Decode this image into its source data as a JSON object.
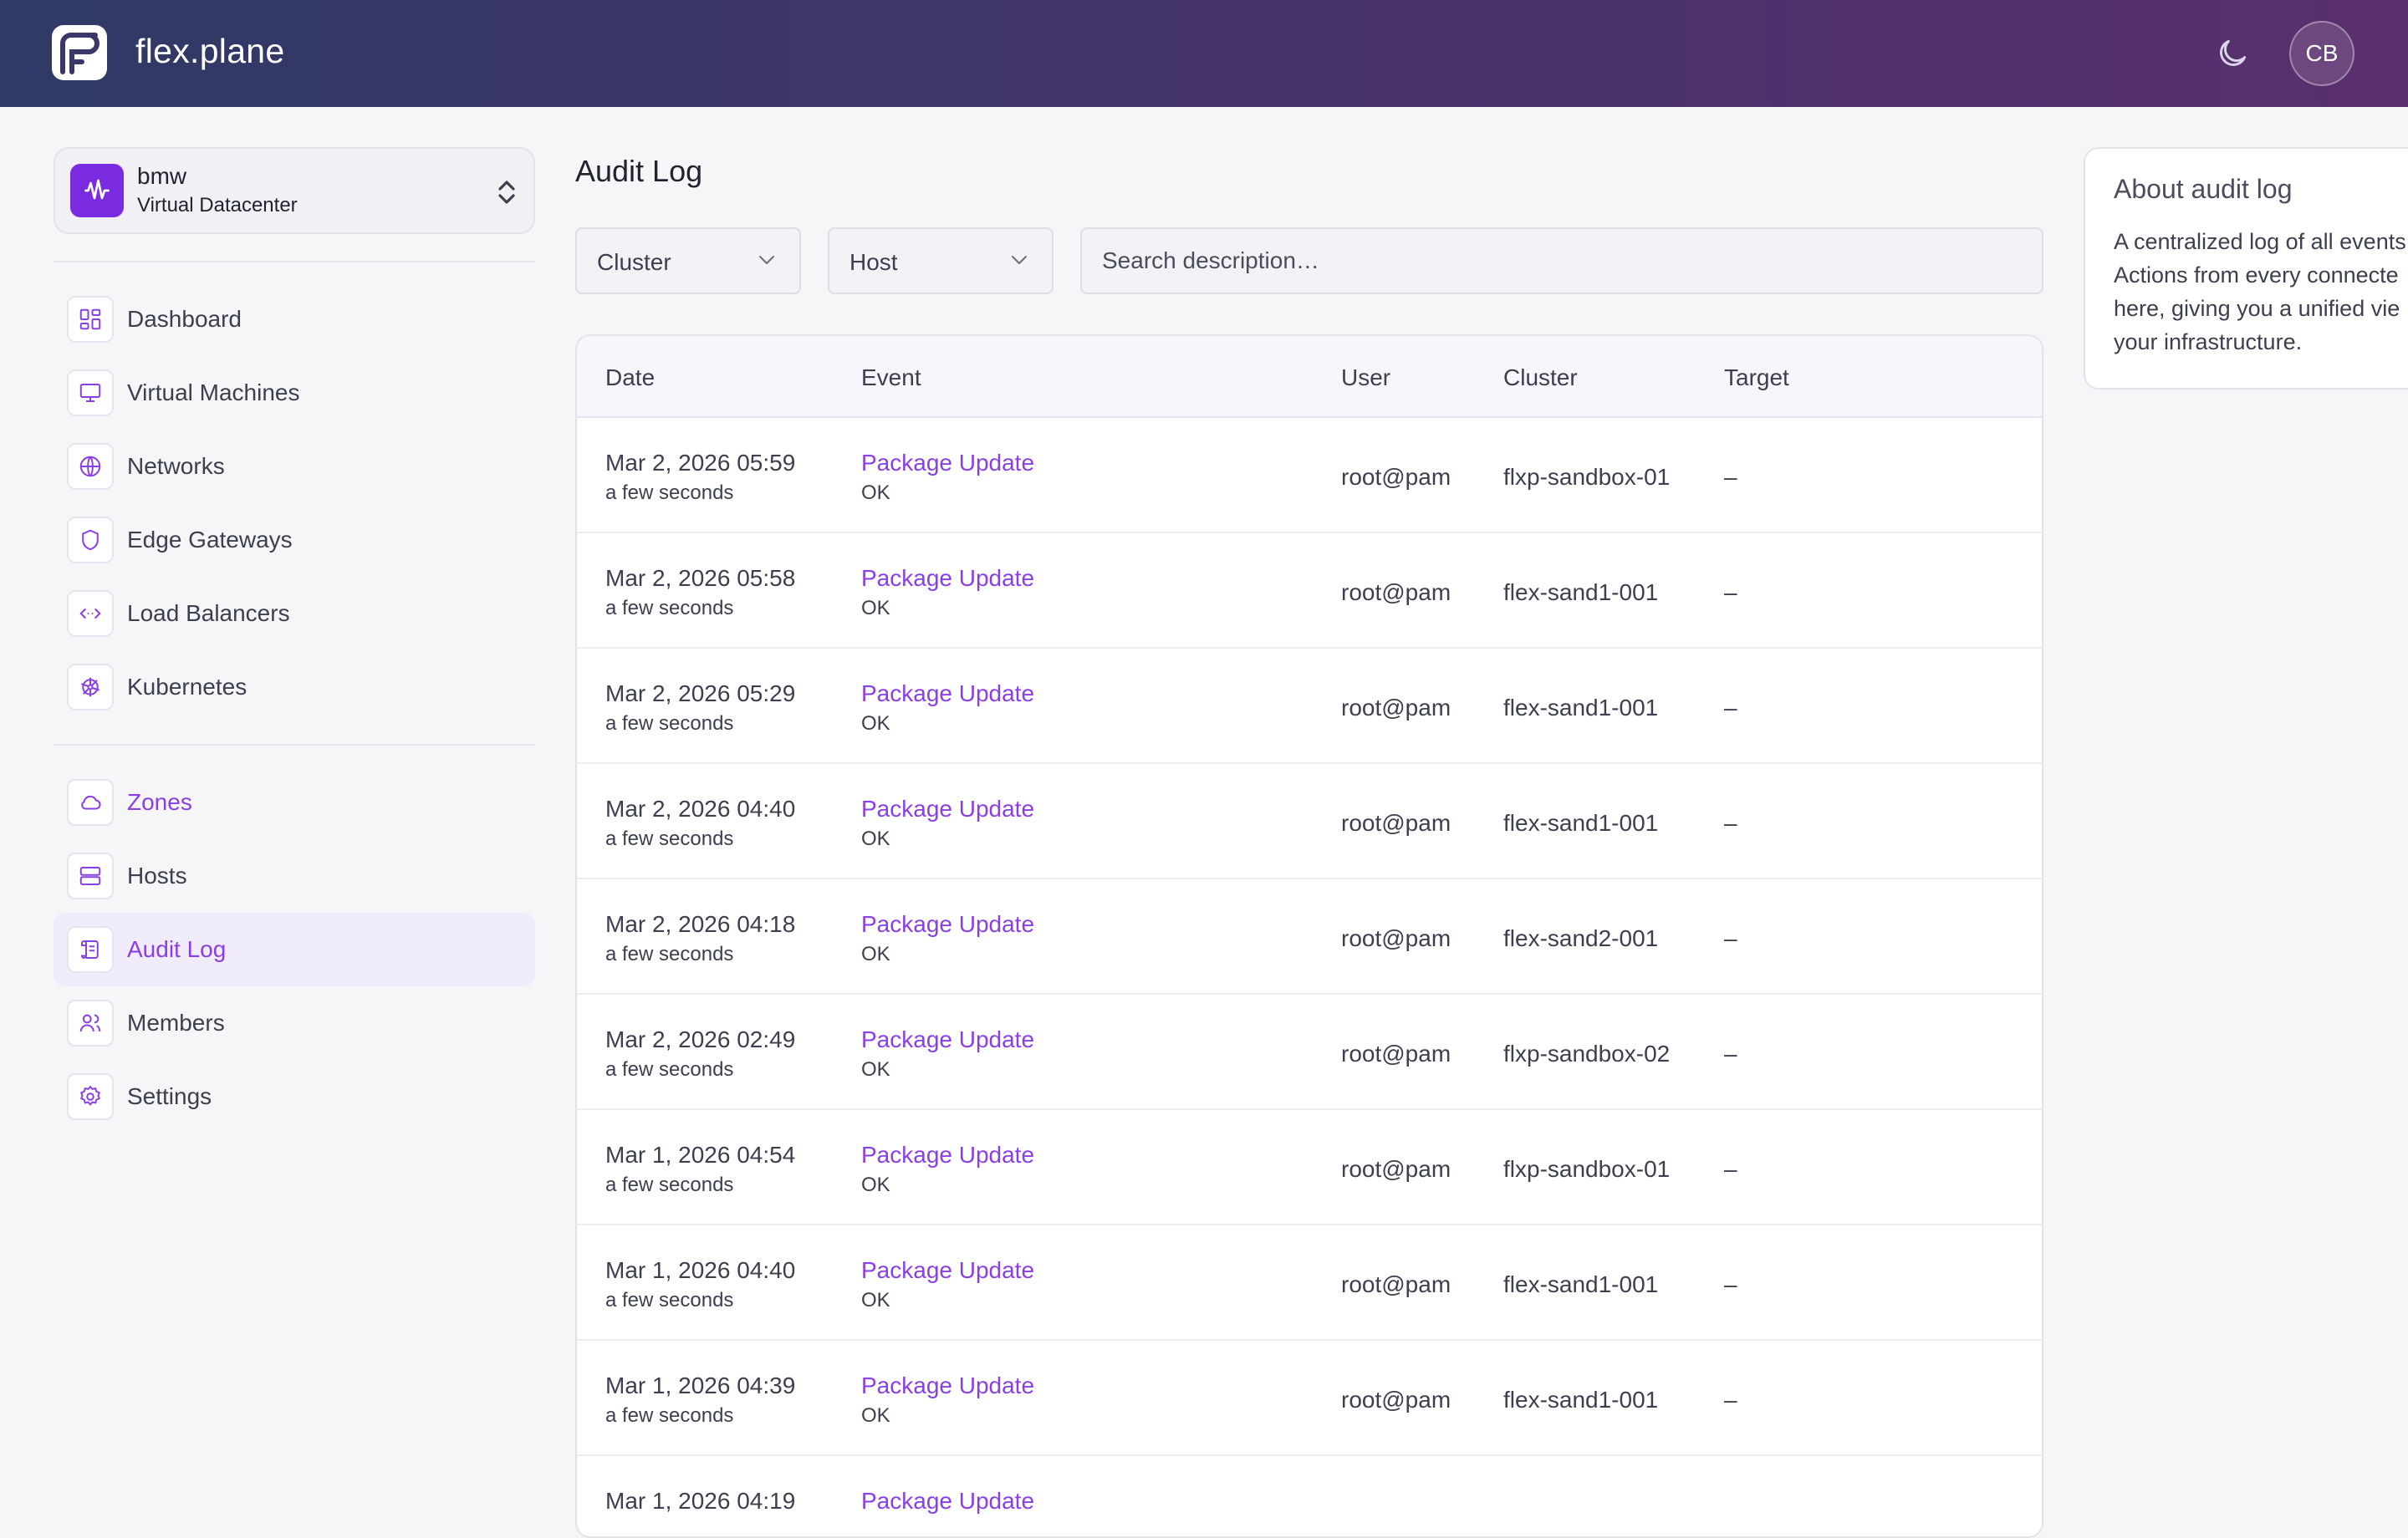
{
  "header": {
    "brand": "flex.plane",
    "avatar_initials": "CB",
    "theme_icon": "moon-icon",
    "colors": {
      "gradient_start": "#2f3a66",
      "gradient_end": "#5a2f6e"
    }
  },
  "sidebar": {
    "vdc": {
      "name": "bmw",
      "type": "Virtual Datacenter",
      "accent": "#7a2be0"
    },
    "items": [
      {
        "label": "Dashboard",
        "icon": "dashboard-icon"
      },
      {
        "label": "Virtual Machines",
        "icon": "monitor-icon"
      },
      {
        "label": "Networks",
        "icon": "globe-icon"
      },
      {
        "label": "Edge Gateways",
        "icon": "shield-icon"
      },
      {
        "label": "Load Balancers",
        "icon": "code-arrows-icon"
      },
      {
        "label": "Kubernetes",
        "icon": "helm-wheel-icon"
      }
    ],
    "items2": [
      {
        "label": "Zones",
        "icon": "cloud-icon"
      },
      {
        "label": "Hosts",
        "icon": "server-icon"
      },
      {
        "label": "Audit Log",
        "icon": "scroll-icon",
        "active": true
      },
      {
        "label": "Members",
        "icon": "users-icon"
      },
      {
        "label": "Settings",
        "icon": "gear-icon"
      }
    ]
  },
  "main": {
    "title": "Audit Log",
    "filters": {
      "cluster": "Cluster",
      "host": "Host",
      "search_placeholder": "Search description…"
    },
    "table": {
      "columns": [
        "Date",
        "Event",
        "User",
        "Cluster",
        "Target"
      ],
      "rows": [
        {
          "date": "Mar 2, 2026 05:59",
          "relative": "a few seconds",
          "event": "Package Update",
          "status": "OK",
          "user": "root@pam",
          "cluster": "flxp-sandbox-01",
          "target": "–"
        },
        {
          "date": "Mar 2, 2026 05:58",
          "relative": "a few seconds",
          "event": "Package Update",
          "status": "OK",
          "user": "root@pam",
          "cluster": "flex-sand1-001",
          "target": "–"
        },
        {
          "date": "Mar 2, 2026 05:29",
          "relative": "a few seconds",
          "event": "Package Update",
          "status": "OK",
          "user": "root@pam",
          "cluster": "flex-sand1-001",
          "target": "–"
        },
        {
          "date": "Mar 2, 2026 04:40",
          "relative": "a few seconds",
          "event": "Package Update",
          "status": "OK",
          "user": "root@pam",
          "cluster": "flex-sand1-001",
          "target": "–"
        },
        {
          "date": "Mar 2, 2026 04:18",
          "relative": "a few seconds",
          "event": "Package Update",
          "status": "OK",
          "user": "root@pam",
          "cluster": "flex-sand2-001",
          "target": "–"
        },
        {
          "date": "Mar 2, 2026 02:49",
          "relative": "a few seconds",
          "event": "Package Update",
          "status": "OK",
          "user": "root@pam",
          "cluster": "flxp-sandbox-02",
          "target": "–"
        },
        {
          "date": "Mar 1, 2026 04:54",
          "relative": "a few seconds",
          "event": "Package Update",
          "status": "OK",
          "user": "root@pam",
          "cluster": "flxp-sandbox-01",
          "target": "–"
        },
        {
          "date": "Mar 1, 2026 04:40",
          "relative": "a few seconds",
          "event": "Package Update",
          "status": "OK",
          "user": "root@pam",
          "cluster": "flex-sand1-001",
          "target": "–"
        },
        {
          "date": "Mar 1, 2026 04:39",
          "relative": "a few seconds",
          "event": "Package Update",
          "status": "OK",
          "user": "root@pam",
          "cluster": "flex-sand1-001",
          "target": "–"
        },
        {
          "date": "Mar 1, 2026 04:19",
          "relative": "",
          "event": "Package Update",
          "status": "",
          "user": "",
          "cluster": "",
          "target": ""
        }
      ]
    }
  },
  "about": {
    "title": "About audit log",
    "lines": [
      "A centralized log of all events",
      "Actions from every connecte",
      "here, giving you a unified vie",
      "your infrastructure."
    ]
  },
  "colors": {
    "accent": "#8a3ee6",
    "active_bg": "#f1ecfb"
  }
}
